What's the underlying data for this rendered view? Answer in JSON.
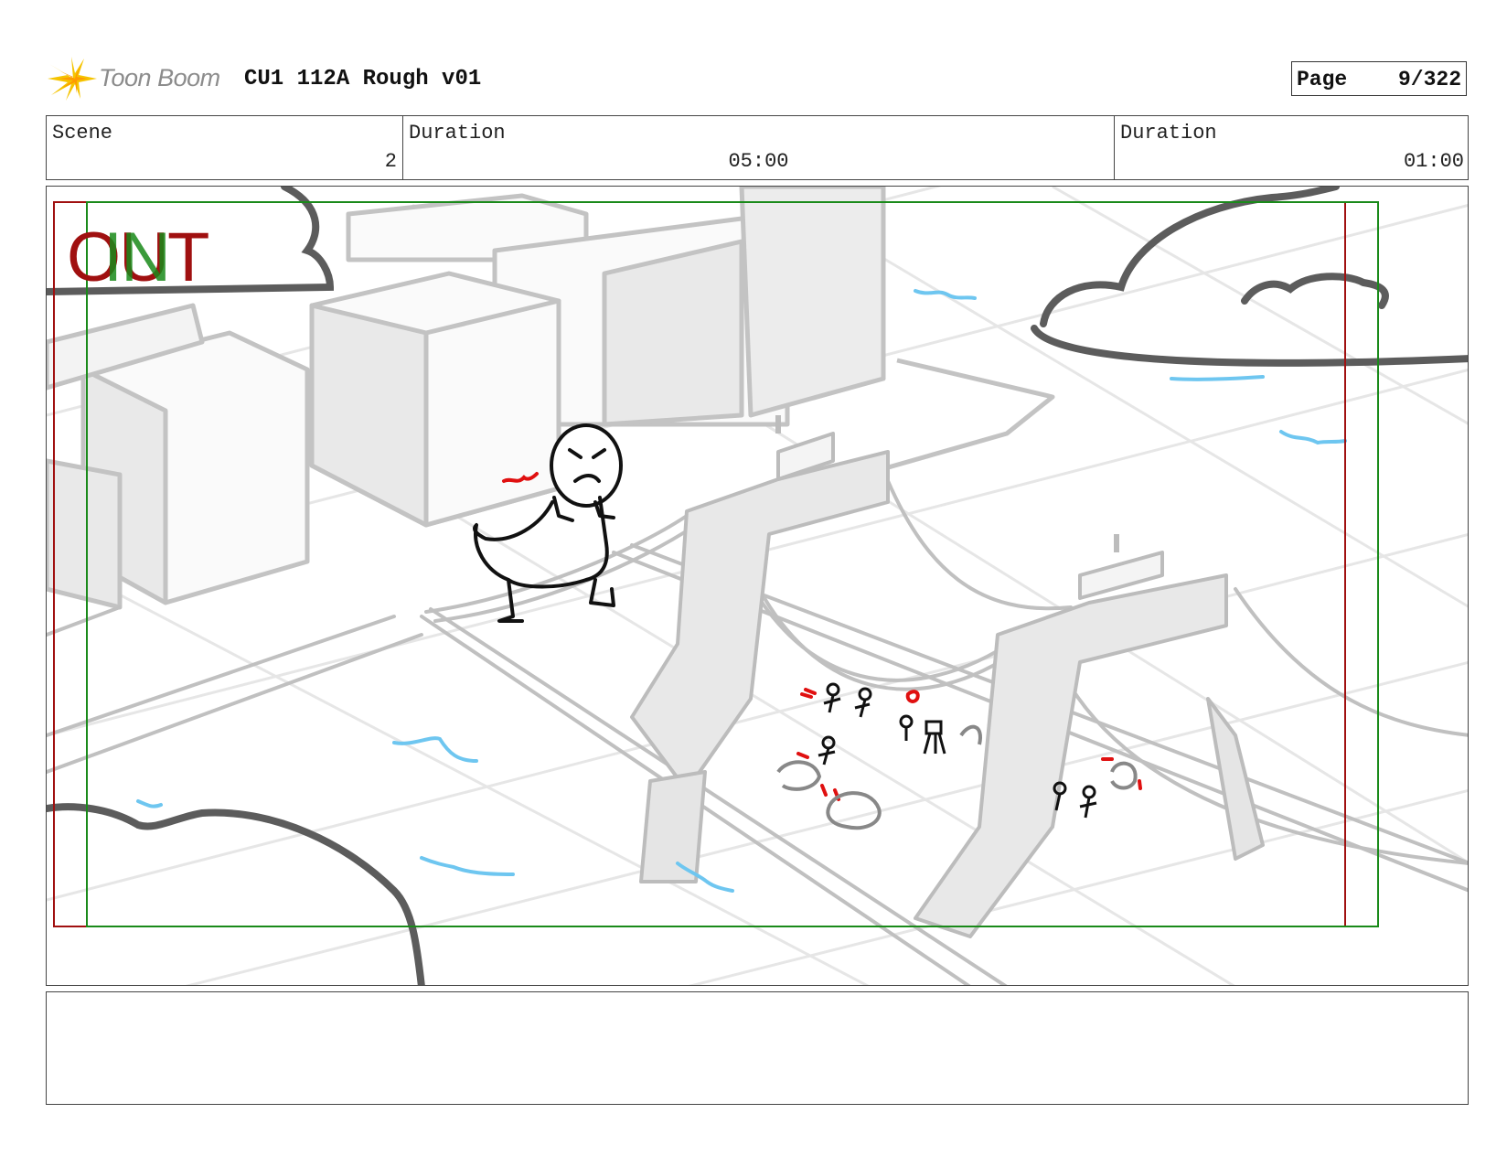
{
  "header": {
    "logo_text": "Toon Boom",
    "title": "CU1 112A Rough v01",
    "page_label": "Page",
    "page_value": "9/322"
  },
  "info": {
    "scene_label": "Scene",
    "scene_value": "2",
    "duration1_label": "Duration",
    "duration1_value": "05:00",
    "duration2_label": "Duration",
    "duration2_value": "01:00"
  },
  "panel": {
    "out_label": "OUT",
    "in_label": "IN"
  },
  "notes": {
    "text": ""
  },
  "colors": {
    "out_frame": "#a01010",
    "in_frame": "#1a8a1a",
    "sketch_gray": "#bdbdbd",
    "water_blue": "#6ec6f0",
    "action_red": "#e01010"
  }
}
